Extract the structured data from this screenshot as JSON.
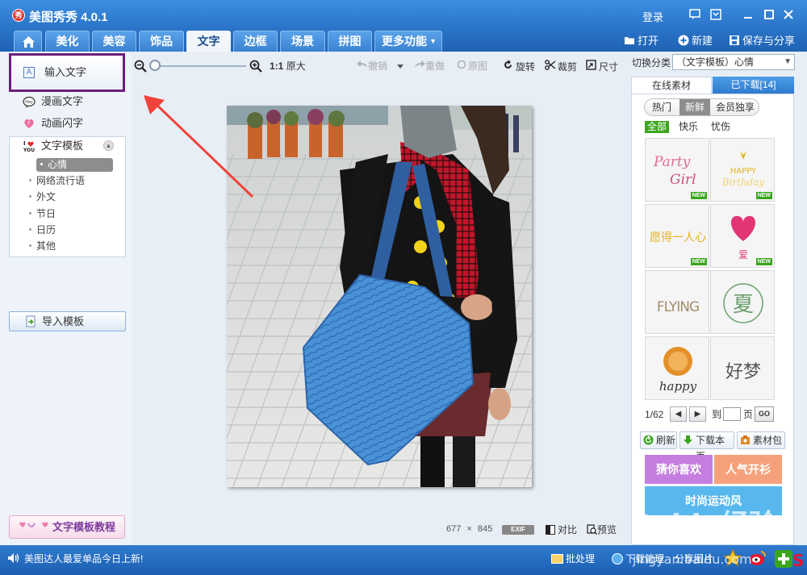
{
  "app": {
    "logo_text": "秀",
    "title": "美图秀秀 4.0.1",
    "login": "登录"
  },
  "nav": {
    "tabs": [
      {
        "label": "美化"
      },
      {
        "label": "美容"
      },
      {
        "label": "饰品"
      },
      {
        "label": "文字",
        "active": true
      },
      {
        "label": "边框"
      },
      {
        "label": "场景"
      },
      {
        "label": "拼图"
      },
      {
        "label": "更多功能"
      }
    ],
    "open": "打开",
    "new": "新建",
    "save_share": "保存与分享"
  },
  "left": {
    "input_text": "输入文字",
    "comic_text": "漫画文字",
    "animated_text": "动画闪字",
    "template_header": "文字模板",
    "template_subs": [
      "心情",
      "网络流行语",
      "外文",
      "节日",
      "日历",
      "其他"
    ],
    "import_template": "导入模板",
    "tutorial": "文字模板教程"
  },
  "toolbar": {
    "actual_size_prefix": "1:1",
    "actual_size": "原大",
    "undo": "撤销",
    "redo": "重做",
    "original": "原图",
    "rotate": "旋转",
    "crop": "裁剪",
    "size": "尺寸"
  },
  "canvas": {
    "width": "677",
    "times": "×",
    "height": "845",
    "exif": "EXIF",
    "compare": "对比",
    "preview": "预览"
  },
  "right": {
    "switch_label": "切换分类",
    "switch_value": "（文字模板）心情",
    "tab_online": "在线素材",
    "tab_downloaded": "已下载[14]",
    "pills": [
      "热门",
      "新鲜",
      "会员独享"
    ],
    "filters": [
      "全部",
      "快乐",
      "忧伤"
    ],
    "thumbs": [
      {
        "text": "Party Girl",
        "new": "NEW",
        "color": "#d04f7e"
      },
      {
        "text": "HAPPY Birthday",
        "new": "NEW",
        "color": "#e2b31b"
      },
      {
        "text": "愿得一人心",
        "new": "NEW",
        "color": "#e3b21f"
      },
      {
        "text": "爱",
        "new": "NEW",
        "color": "#e23576"
      },
      {
        "text": "FLYING",
        "new": "",
        "color": "#a38d6a"
      },
      {
        "text": "夏",
        "new": "",
        "color": "#6aa06a"
      },
      {
        "text": "happy",
        "new": "",
        "color": "#e4902a"
      },
      {
        "text": "好梦",
        "new": "",
        "color": "#555555"
      }
    ],
    "page_current": "1/62",
    "page_to": "到",
    "page_unit": "页",
    "go": "GO",
    "refresh": "刷新",
    "download_page": "下载本页",
    "package": "素材包",
    "promo1": "猜你喜欢",
    "promo2": "人气开衫",
    "promo3": "时尚运动风"
  },
  "status": {
    "message": "美图达人最爱单品今日上新!",
    "batch": "批处理",
    "download_mgr": "下载管理",
    "share_pic": "分享图片"
  },
  "watermark": {
    "brand": "Baidu经验",
    "url": "jingyan.baidu.com"
  }
}
